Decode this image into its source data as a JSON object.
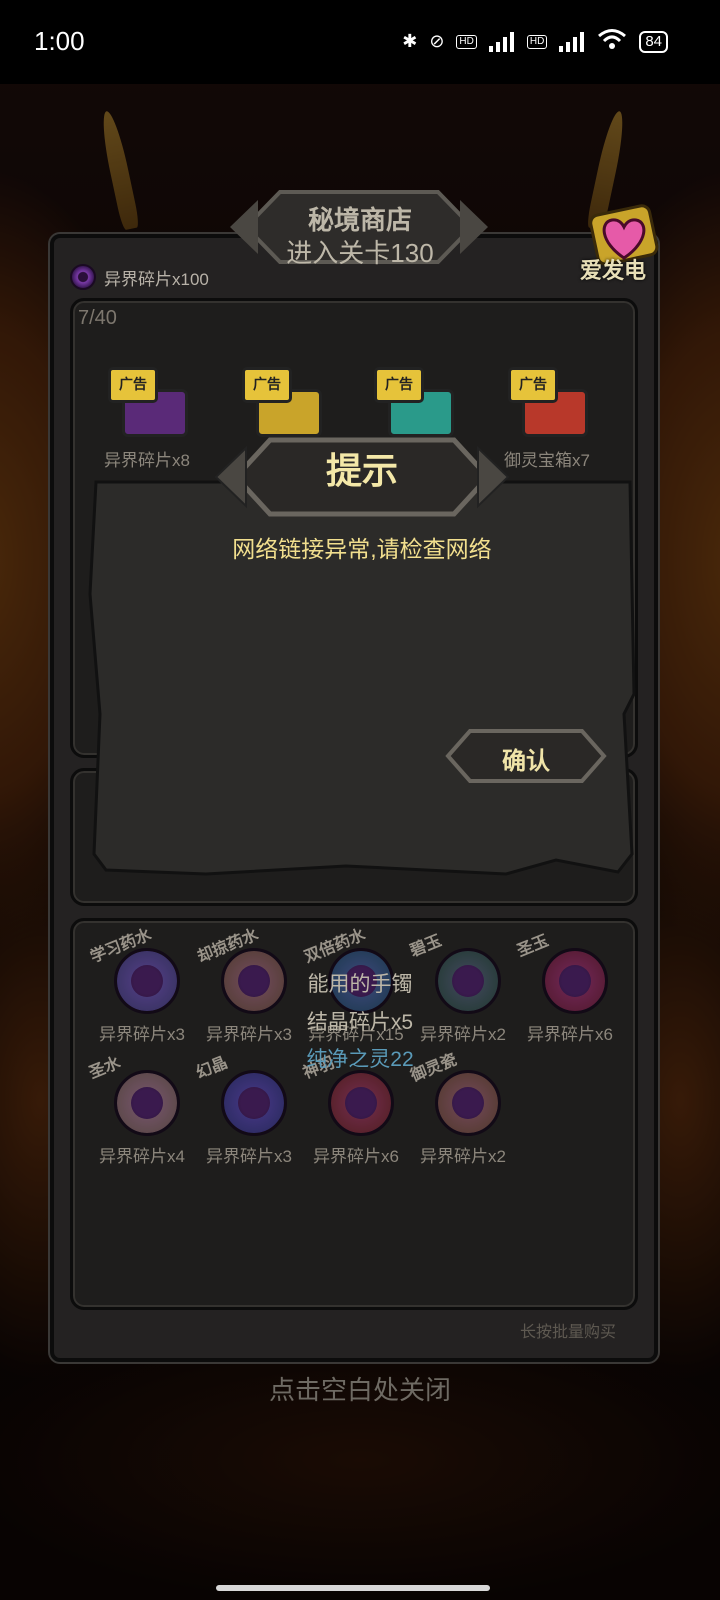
{
  "status_bar": {
    "time": "1:00",
    "battery": "84",
    "hd1": "HD",
    "hd2": "HD",
    "icons": [
      "bluetooth-icon",
      "mute-vibrate-icon",
      "signal-icon",
      "signal-icon",
      "wifi-icon",
      "battery-icon"
    ]
  },
  "shop": {
    "title": "秘境商店",
    "subtitle": "进入关卡130",
    "currency": "异界碎片x100",
    "charge_label": "爱发电",
    "counter": "7/40",
    "ad_tag": "广告",
    "ad_items": [
      {
        "label": "异界碎片x8",
        "color": "#5a2a78"
      },
      {
        "label": "",
        "color": "#c9a42a"
      },
      {
        "label": "",
        "color": "#2a9a8a"
      },
      {
        "label": "御灵宝箱x7",
        "color": "#b8382a"
      }
    ],
    "potions_row1": [
      {
        "name": "学习药水",
        "cost": "异界碎片x3",
        "color": "#6f7fd8"
      },
      {
        "name": "却掠药水",
        "cost": "异界碎片x3",
        "color": "#c9a25a"
      },
      {
        "name": "双倍药水",
        "cost": "异界碎片x15",
        "color": "#2a9ab0"
      },
      {
        "name": "碧玉",
        "cost": "异界碎片x2",
        "color": "#3a9a5a"
      },
      {
        "name": "圣玉",
        "cost": "异界碎片x6",
        "color": "#c83a4a"
      }
    ],
    "potions_row2": [
      {
        "name": "圣水",
        "cost": "异界碎片x4",
        "color": "#d8c08a"
      },
      {
        "name": "幻晶",
        "cost": "异界碎片x3",
        "color": "#4a6ad8"
      },
      {
        "name": "神羽",
        "cost": "异界碎片x6",
        "color": "#c8482a"
      },
      {
        "name": "御灵瓷",
        "cost": "异界碎片x2",
        "color": "#c89a4a"
      }
    ],
    "tooltip_line1": "能用的手镯",
    "tooltip_line2": "结晶碎片x5",
    "tooltip_line3": "纯净之灵22",
    "batch_hint": "长按批量购买",
    "close_hint": "点击空白处关闭"
  },
  "dialog": {
    "title": "提示",
    "message": "网络链接异常,请检查网络",
    "confirm": "确认"
  }
}
